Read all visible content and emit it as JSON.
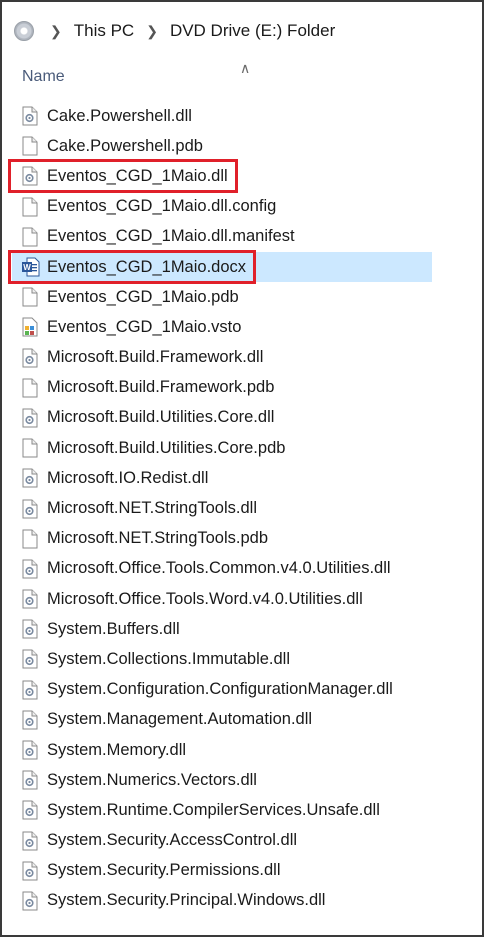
{
  "address": {
    "crumbs": [
      "This PC",
      "DVD Drive (E:) Folder"
    ]
  },
  "header": {
    "name_label": "Name"
  },
  "files": [
    {
      "name": "Cake.Powershell.dll",
      "icon": "dll-icon"
    },
    {
      "name": "Cake.Powershell.pdb",
      "icon": "file-icon"
    },
    {
      "name": "Eventos_CGD_1Maio.dll",
      "icon": "dll-icon",
      "highlight": true
    },
    {
      "name": "Eventos_CGD_1Maio.dll.config",
      "icon": "file-icon"
    },
    {
      "name": "Eventos_CGD_1Maio.dll.manifest",
      "icon": "file-icon"
    },
    {
      "name": "Eventos_CGD_1Maio.docx",
      "icon": "word-icon",
      "highlight": true,
      "selected": true
    },
    {
      "name": "Eventos_CGD_1Maio.pdb",
      "icon": "file-icon"
    },
    {
      "name": "Eventos_CGD_1Maio.vsto",
      "icon": "vsto-icon"
    },
    {
      "name": "Microsoft.Build.Framework.dll",
      "icon": "dll-icon"
    },
    {
      "name": "Microsoft.Build.Framework.pdb",
      "icon": "file-icon"
    },
    {
      "name": "Microsoft.Build.Utilities.Core.dll",
      "icon": "dll-icon"
    },
    {
      "name": "Microsoft.Build.Utilities.Core.pdb",
      "icon": "file-icon"
    },
    {
      "name": "Microsoft.IO.Redist.dll",
      "icon": "dll-icon"
    },
    {
      "name": "Microsoft.NET.StringTools.dll",
      "icon": "dll-icon"
    },
    {
      "name": "Microsoft.NET.StringTools.pdb",
      "icon": "file-icon"
    },
    {
      "name": "Microsoft.Office.Tools.Common.v4.0.Utilities.dll",
      "icon": "dll-icon"
    },
    {
      "name": "Microsoft.Office.Tools.Word.v4.0.Utilities.dll",
      "icon": "dll-icon"
    },
    {
      "name": "System.Buffers.dll",
      "icon": "dll-icon"
    },
    {
      "name": "System.Collections.Immutable.dll",
      "icon": "dll-icon"
    },
    {
      "name": "System.Configuration.ConfigurationManager.dll",
      "icon": "dll-icon"
    },
    {
      "name": "System.Management.Automation.dll",
      "icon": "dll-icon"
    },
    {
      "name": "System.Memory.dll",
      "icon": "dll-icon"
    },
    {
      "name": "System.Numerics.Vectors.dll",
      "icon": "dll-icon"
    },
    {
      "name": "System.Runtime.CompilerServices.Unsafe.dll",
      "icon": "dll-icon"
    },
    {
      "name": "System.Security.AccessControl.dll",
      "icon": "dll-icon"
    },
    {
      "name": "System.Security.Permissions.dll",
      "icon": "dll-icon"
    },
    {
      "name": "System.Security.Principal.Windows.dll",
      "icon": "dll-icon"
    }
  ],
  "colors": {
    "highlight_border": "#e0202a",
    "selection_bg": "#cce8ff"
  }
}
